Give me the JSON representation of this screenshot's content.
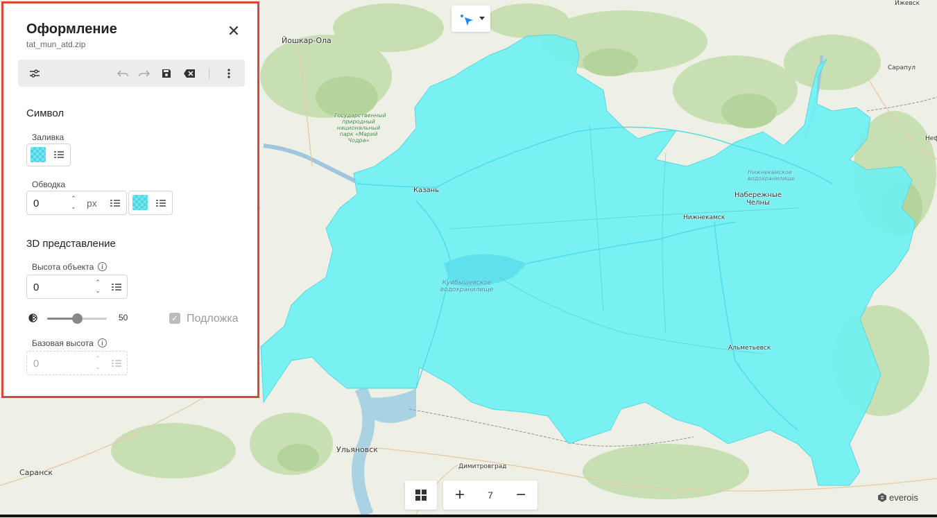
{
  "panel": {
    "title": "Оформление",
    "subtitle": "tat_mun_atd.zip",
    "close_glyph": "✕"
  },
  "toolbar": {
    "icons": [
      "sliders-icon",
      "undo-icon",
      "redo-icon",
      "save-icon",
      "clear-icon",
      "more-vertical-icon"
    ]
  },
  "symbol": {
    "section_title": "Символ",
    "fill_label": "Заливка",
    "stroke_label": "Обводка",
    "stroke_width": "0",
    "stroke_unit": "px",
    "fill_color": "#6fe6f0"
  },
  "threed": {
    "section_title": "3D представление",
    "height_label": "Высота объекта",
    "height_value": "0",
    "opacity_value": "50",
    "opacity_percent": 50,
    "base_checkbox_label": "Подложка",
    "base_checked": true,
    "base_height_label": "Базовая высота",
    "base_height_value": "0"
  },
  "map": {
    "region_color": "#6ff0f2",
    "labels": {
      "yoshkar_ola": "Йошкар-Ола",
      "kazan": "Казань",
      "naberezhnye": "Набережные Челны",
      "nizhnekamsk": "Нижнекамск",
      "almetyevsk": "Альметьевск",
      "ulyanovsk": "Ульяновск",
      "dimitrovgrad": "Димитровград",
      "saransk": "Саранск",
      "sarapul": "Сарапул",
      "izhevsk": "Ижевск",
      "neftekamsk": "Неф",
      "reservoir": "Куйбышевское водохранилище",
      "nizhnekamsk_reservoir": "Нижнекамское водохранилище",
      "park": "Государственный природный национальный парк «Марий Чодра»"
    }
  },
  "controls": {
    "zoom_level": "7",
    "zoom_in": "+",
    "zoom_out": "−",
    "logo": "everois"
  }
}
